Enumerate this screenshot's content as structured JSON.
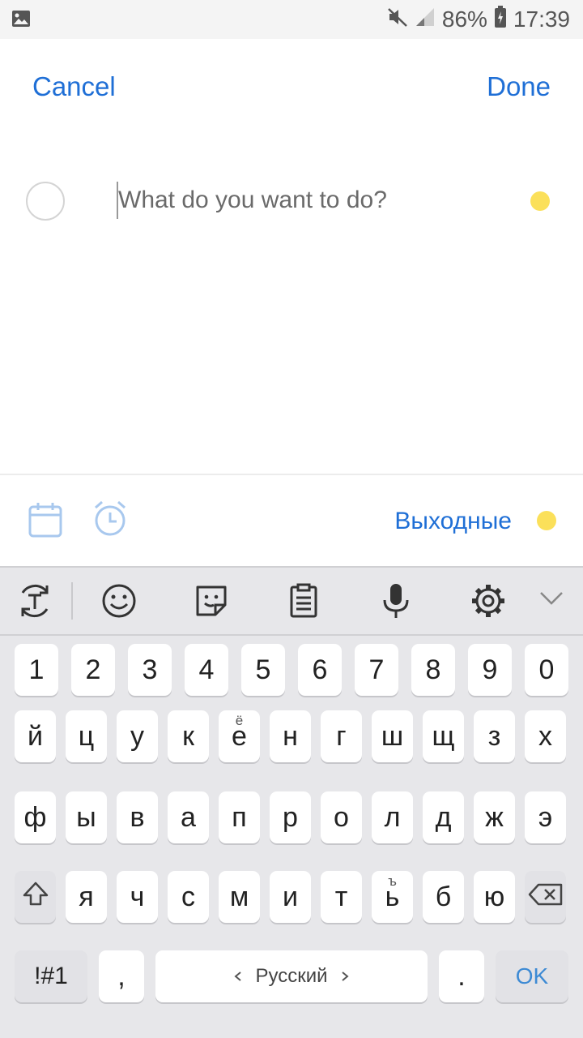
{
  "status_bar": {
    "battery": "86%",
    "time": "17:39"
  },
  "header": {
    "cancel": "Cancel",
    "done": "Done"
  },
  "task": {
    "placeholder": "What do you want to do?",
    "value": ""
  },
  "toolbar": {
    "list_name": "Выходные"
  },
  "colors": {
    "accent": "#1f6fd6",
    "list_dot": "#fbe05a",
    "keyboard_bg": "#e7e7ea"
  },
  "keyboard": {
    "number_row": [
      "1",
      "2",
      "3",
      "4",
      "5",
      "6",
      "7",
      "8",
      "9",
      "0"
    ],
    "row1": [
      "й",
      "ц",
      "у",
      "к",
      "е",
      "н",
      "г",
      "ш",
      "щ",
      "з",
      "х"
    ],
    "row1_hint": "ё",
    "row2": [
      "ф",
      "ы",
      "в",
      "а",
      "п",
      "р",
      "о",
      "л",
      "д",
      "ж",
      "э"
    ],
    "row3": [
      "я",
      "ч",
      "с",
      "м",
      "и",
      "т",
      "ь",
      "б",
      "ю"
    ],
    "row3_hint": "ъ",
    "symbols": "!#1",
    "comma": ",",
    "space": "Русский",
    "period": ".",
    "ok": "OK"
  }
}
